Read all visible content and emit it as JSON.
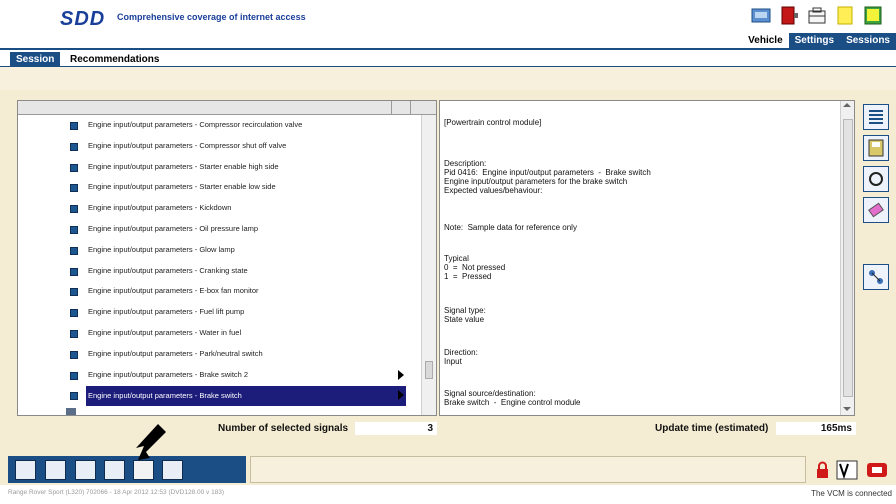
{
  "app": {
    "logo": "SDD",
    "tagline": "Comprehensive coverage of internet access"
  },
  "header_icons": [
    "vehicle-car-icon",
    "vehicle-ecu-icon",
    "toolbox-icon",
    "note-icon",
    "sessions-icon"
  ],
  "top_tabs": [
    "Vehicle",
    "Settings",
    "Sessions"
  ],
  "session_tabs": {
    "session": "Session",
    "recommendations": "Recommendations"
  },
  "signals": [
    "Engine input/output parameters  -  Compressor recirculation valve",
    "Engine input/output parameters  -  Compressor shut off valve",
    "Engine input/output parameters  -  Starter enable high side",
    "Engine input/output parameters  -  Starter enable low side",
    "Engine input/output parameters  -  Kickdown",
    "Engine input/output parameters  -  Oil pressure lamp",
    "Engine input/output parameters  -  Glow lamp",
    "Engine input/output parameters  -  Cranking state",
    "Engine input/output parameters  -  E-box fan monitor",
    "Engine input/output parameters  -  Fuel lift pump",
    "Engine input/output parameters  -  Water in fuel",
    "Engine input/output parameters  -  Park/neutral switch",
    "Engine input/output parameters  -  Brake switch 2",
    "Engine input/output parameters  -  Brake switch"
  ],
  "selected_index": 13,
  "description": {
    "module": "[Powertrain control module]",
    "desc_heading": "Description:",
    "pid_line": "Pid 0416:  Engine input/output parameters  -  Brake switch",
    "desc_line": "Engine input/output parameters for the brake switch",
    "expected": "Expected values/behaviour:",
    "note": "Note:  Sample data for reference only",
    "typical_heading": "Typical",
    "typical_0": "0  =  Not pressed",
    "typical_1": "1  =  Pressed",
    "signal_type_heading": "Signal type:",
    "signal_type_value": "State value",
    "direction_heading": "Direction:",
    "direction_value": "Input",
    "source_heading": "Signal source/destination:",
    "source_value": "Brake switch  -  Engine control module"
  },
  "status": {
    "selected_label": "Number of selected signals",
    "selected_value": "3",
    "update_label": "Update time (estimated)",
    "update_value": "165ms"
  },
  "footer": {
    "left": "Range Rover Sport (L320) 702066 - 18 Apr 2012 12:53 (DVD128.00 v 183)",
    "right": "The VCM is connected"
  },
  "colors": {
    "brand_blue": "#1c4e86",
    "panel_bg": "#f4ecd3",
    "selection": "#1c1c7a"
  }
}
